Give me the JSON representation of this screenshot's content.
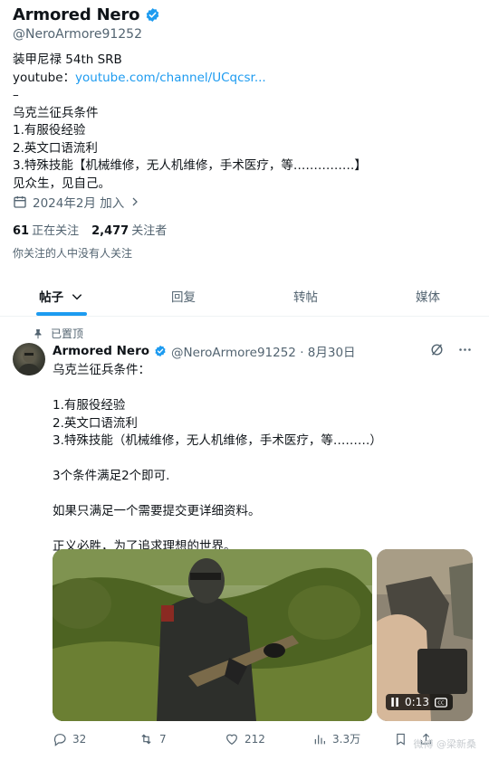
{
  "profile": {
    "display_name": "Armored Nero",
    "handle": "@NeroArmore91252",
    "bio_lines": [
      "装甲尼禄 54th SRB",
      "youtube：",
      "–",
      "乌克兰征兵条件",
      "1.有服役经验",
      "2.英文口语流利",
      "3.特殊技能【机械维修，无人机维修，手术医疗，等……………】",
      "见众生，见自己。"
    ],
    "youtube_link": "youtube.com/channel/UCqcsr...",
    "joined": "2024年2月 加入",
    "following_count": "61",
    "following_label": "正在关注",
    "followers_count": "2,477",
    "followers_label": "关注者",
    "followed_by_text": "你关注的人中没有人关注"
  },
  "tabs": [
    {
      "label": "帖子",
      "active": true
    },
    {
      "label": "回复",
      "active": false
    },
    {
      "label": "转帖",
      "active": false
    },
    {
      "label": "媒体",
      "active": false
    }
  ],
  "tweet": {
    "pinned_label": "已置顶",
    "name": "Armored Nero",
    "handle_date": "@NeroArmore91252 · 8月30日",
    "body_lines": [
      "乌克兰征兵条件：",
      "",
      "1.有服役经验",
      "2.英文口语流利",
      "3.特殊技能（机械维修，无人机维修，手术医疗，等………）",
      "",
      "3个条件满足2个即可.",
      "",
      "如果只满足一个需要提交更详细资料。",
      "",
      "正义必胜，为了追求理想的世界。"
    ],
    "video_duration": "0:13",
    "replies": "32",
    "reposts": "7",
    "likes": "212",
    "views": "3.3万"
  },
  "watermark": "微博 @梁新桑",
  "colors": {
    "accent": "#1d9bf0",
    "muted": "#536471",
    "text": "#0f1419"
  }
}
